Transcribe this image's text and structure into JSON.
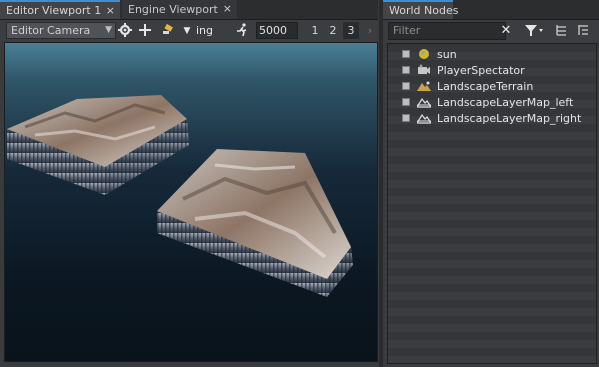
{
  "tabs_left": [
    {
      "label": "Editor Viewport 1",
      "close": "×",
      "active": true
    },
    {
      "label": "Engine Viewport",
      "close": "×",
      "active": false
    }
  ],
  "tabs_right": [
    {
      "label": "World Nodes",
      "close": "×",
      "active": true
    }
  ],
  "toolbar": {
    "camera_label": "Editor Camera",
    "mode_label": "ing",
    "speed_value": "5000",
    "buttons": [
      "1",
      "2",
      "3"
    ],
    "selected_button": "3"
  },
  "world_nodes": {
    "filter_placeholder": "Filter",
    "items": [
      {
        "label": "sun",
        "icon": "sun-icon"
      },
      {
        "label": "PlayerSpectator",
        "icon": "camera-icon"
      },
      {
        "label": "LandscapeTerrain",
        "icon": "landscape-icon"
      },
      {
        "label": "LandscapeLayerMap_left",
        "icon": "layer-map-icon"
      },
      {
        "label": "LandscapeLayerMap_right",
        "icon": "layer-map-icon"
      }
    ]
  },
  "colors": {
    "accent": "#3f8ed1",
    "panel": "#3a3b3d",
    "viewport_sky": "#4b7f95"
  }
}
